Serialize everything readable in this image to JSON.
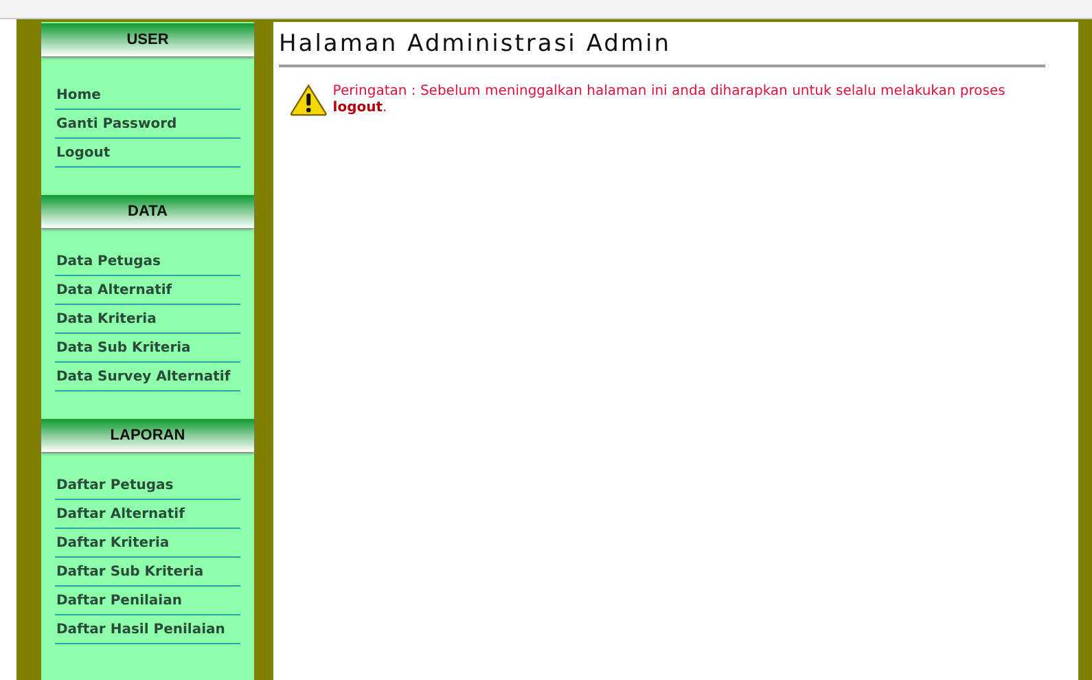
{
  "sidebar": {
    "sections": [
      {
        "title": "USER",
        "items": [
          "Home",
          "Ganti Password",
          "Logout"
        ]
      },
      {
        "title": "DATA",
        "items": [
          "Data Petugas",
          "Data Alternatif",
          "Data Kriteria",
          "Data Sub Kriteria",
          "Data Survey Alternatif"
        ]
      },
      {
        "title": "LAPORAN",
        "items": [
          "Daftar Petugas",
          "Daftar Alternatif",
          "Daftar Kriteria",
          "Daftar Sub Kriteria",
          "Daftar Penilaian",
          "Daftar Hasil Penilaian"
        ]
      }
    ]
  },
  "main": {
    "title": "Halaman Administrasi Admin",
    "warning": "Peringatan : Sebelum meninggalkan halaman ini anda diharapkan untuk selalu melakukan proses **logout**."
  }
}
